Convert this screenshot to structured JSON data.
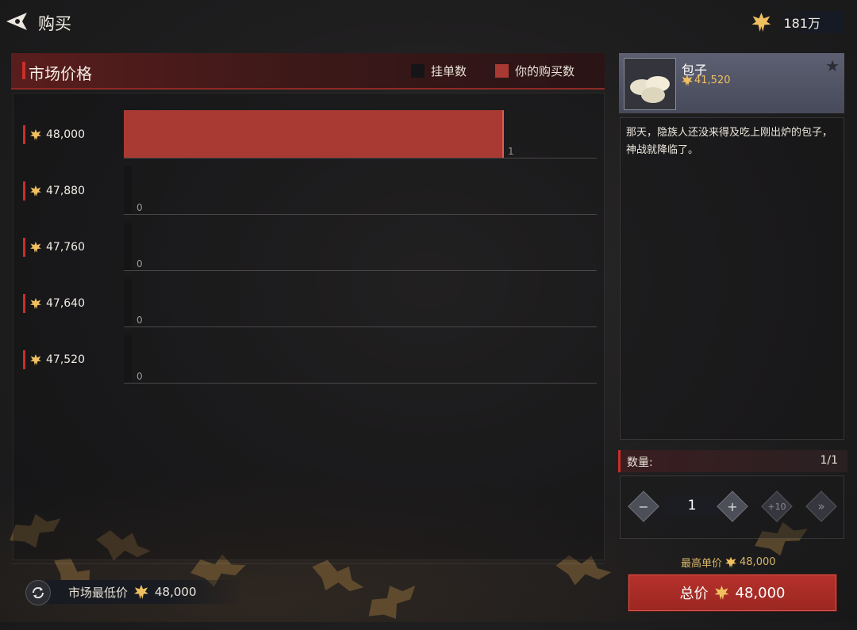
{
  "header": {
    "title": "购买",
    "currency_amount": "181万"
  },
  "market": {
    "title": "市场价格",
    "legend": [
      {
        "label": "挂单数",
        "color": "#151518"
      },
      {
        "label": "你的购买数",
        "color": "#a93a33"
      }
    ],
    "rows": [
      {
        "price": "48,000",
        "count": "1",
        "fill": 0.9
      },
      {
        "price": "47,880",
        "count": "0",
        "fill": 0
      },
      {
        "price": "47,760",
        "count": "0",
        "fill": 0
      },
      {
        "price": "47,640",
        "count": "0",
        "fill": 0
      },
      {
        "price": "47,520",
        "count": "0",
        "fill": 0
      }
    ],
    "lowest_label": "市场最低价",
    "lowest_value": "48,000"
  },
  "item": {
    "name": "包子",
    "price": "41,520",
    "description": "那天，隐族人还没来得及吃上刚出炉的包子，神战就降临了。"
  },
  "quantity": {
    "label": "数量:",
    "ratio": "1/1",
    "value": "1",
    "plus_ten": "+10"
  },
  "purchase": {
    "max_label": "最高单价",
    "max_value": "48,000",
    "total_label": "总价",
    "total_value": "48,000"
  },
  "colors": {
    "accent": "#c8302a",
    "gold": "#f0c060",
    "bar": "#a93a33"
  }
}
